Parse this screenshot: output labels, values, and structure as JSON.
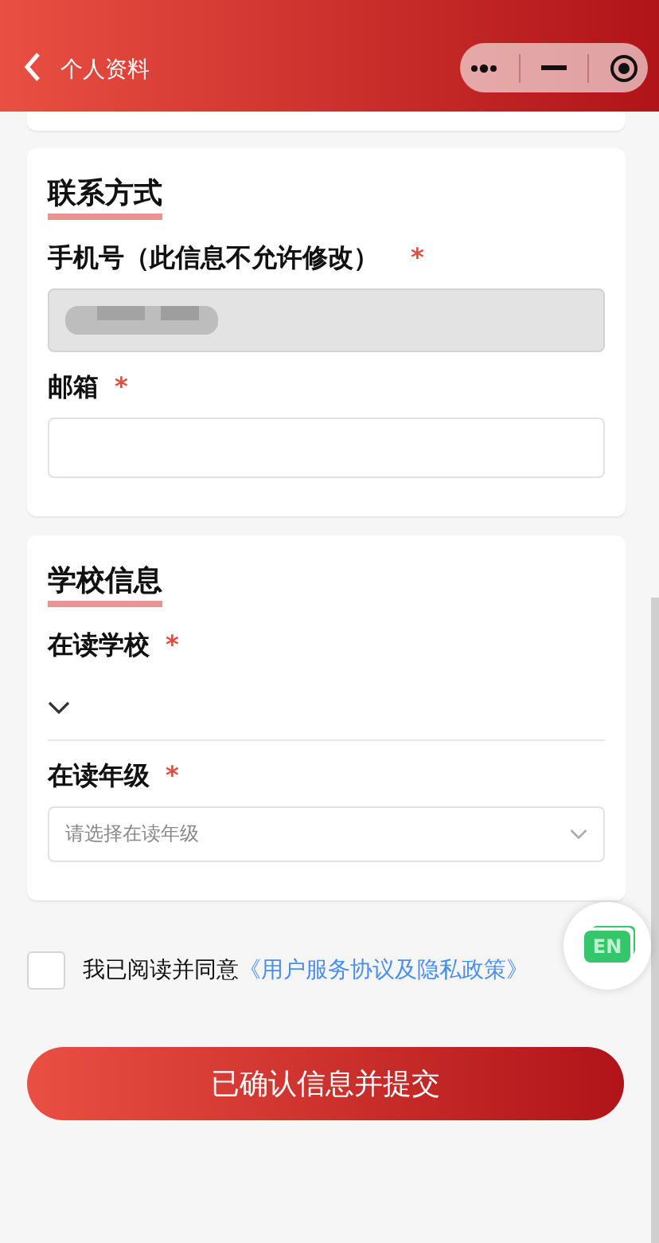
{
  "header": {
    "title": "个人资料"
  },
  "contact": {
    "title": "联系方式",
    "phone": {
      "label": "手机号（此信息不允许修改）",
      "required_mark": "*",
      "disabled": true
    },
    "email": {
      "label": "邮箱",
      "required_mark": "*"
    }
  },
  "school": {
    "title": "学校信息",
    "school_field": {
      "label": "在读学校",
      "required_mark": "*"
    },
    "grade_field": {
      "label": "在读年级",
      "required_mark": "*",
      "placeholder": "请选择在读年级"
    }
  },
  "agreement": {
    "checked": false,
    "text": "我已阅读并同意",
    "link": "《用户服务协议及隐私政策》"
  },
  "language_badge": "EN",
  "submit": "已确认信息并提交"
}
